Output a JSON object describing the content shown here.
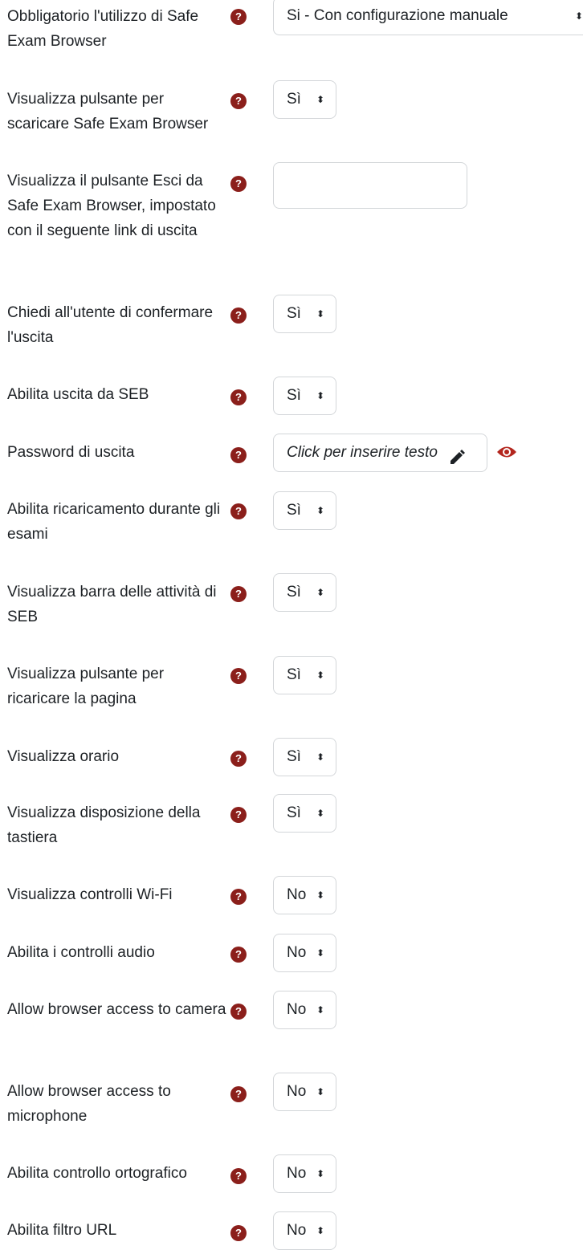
{
  "rows": [
    {
      "label": "Obbligatorio l'utilizzo di Safe Exam Browser",
      "control": "select",
      "value": "Si - Con configurazione manuale"
    },
    {
      "label": "Visualizza pulsante per scaricare Safe Exam Browser",
      "control": "select",
      "value": "Sì"
    },
    {
      "label": "Visualizza il pulsante Esci da Safe Exam Browser, impostato con il seguente link di uscita",
      "control": "text",
      "value": ""
    },
    {
      "label": "Chiedi all'utente di confermare l'uscita",
      "control": "select",
      "value": "Sì"
    },
    {
      "label": "Abilita uscita da SEB",
      "control": "select",
      "value": "Sì"
    },
    {
      "label": "Password di uscita",
      "control": "editable",
      "value": "Click per inserire testo"
    },
    {
      "label": "Abilita ricaricamento durante gli esami",
      "control": "select",
      "value": "Sì"
    },
    {
      "label": "Visualizza barra delle attività di SEB",
      "control": "select",
      "value": "Sì"
    },
    {
      "label": "Visualizza pulsante per ricaricare la pagina",
      "control": "select",
      "value": "Sì"
    },
    {
      "label": "Visualizza orario",
      "control": "select",
      "value": "Sì"
    },
    {
      "label": "Visualizza disposizione della tastiera",
      "control": "select",
      "value": "Sì"
    },
    {
      "label": "Visualizza controlli Wi-Fi",
      "control": "select",
      "value": "No"
    },
    {
      "label": "Abilita i controlli audio",
      "control": "select",
      "value": "No"
    },
    {
      "label": "Allow browser access to camera",
      "control": "select",
      "value": "No"
    },
    {
      "label": "Allow browser access to microphone",
      "control": "select",
      "value": "No"
    },
    {
      "label": "Abilita controllo ortografico",
      "control": "select",
      "value": "No"
    },
    {
      "label": "Abilita filtro URL",
      "control": "select",
      "value": "No"
    }
  ],
  "help_glyph": "?",
  "caret_glyph": "⬍",
  "icons": {
    "help": "question-circle-icon",
    "caret": "sort-caret-icon",
    "pencil": "pencil-icon",
    "eye": "eye-icon"
  },
  "colors": {
    "help_bg": "#8b1f1b",
    "eye": "#b3261e",
    "text": "#1d2125",
    "border": "#d3d6d9"
  }
}
